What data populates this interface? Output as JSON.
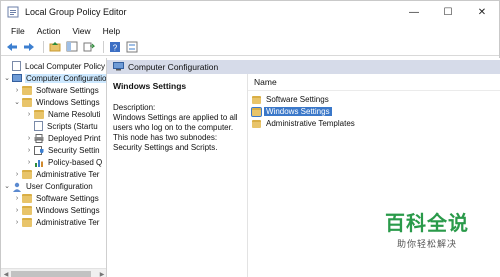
{
  "window": {
    "title": "Local Group Policy Editor",
    "controls": {
      "minimize": "—",
      "maximize": "☐",
      "close": "✕"
    }
  },
  "menu": [
    "File",
    "Action",
    "View",
    "Help"
  ],
  "toolbar": {
    "buttons": [
      "back-arrow-icon",
      "forward-arrow-icon",
      "folder-up-icon",
      "show-hide-tree-icon",
      "export-list-icon",
      "help-icon",
      "properties-icon"
    ]
  },
  "tree": {
    "items": [
      {
        "label": "Local Computer Policy",
        "level": 0,
        "expander": "",
        "icon": "doc-icon"
      },
      {
        "label": "Computer Configuratio",
        "level": 0,
        "expander": "v",
        "icon": "computer-icon",
        "selected": true
      },
      {
        "label": "Software Settings",
        "level": 1,
        "expander": ">",
        "icon": "folder-icon"
      },
      {
        "label": "Windows Settings",
        "level": 1,
        "expander": "v",
        "icon": "folder-icon"
      },
      {
        "label": "Name Resoluti",
        "level": 2,
        "expander": ">",
        "icon": "folder-icon"
      },
      {
        "label": "Scripts (Startu",
        "level": 2,
        "expander": "",
        "icon": "script-icon"
      },
      {
        "label": "Deployed Print",
        "level": 2,
        "expander": ">",
        "icon": "printer-icon"
      },
      {
        "label": "Security Settin",
        "level": 2,
        "expander": ">",
        "icon": "security-icon"
      },
      {
        "label": "Policy-based Q",
        "level": 2,
        "expander": ">",
        "icon": "chart-icon"
      },
      {
        "label": "Administrative Ter",
        "level": 1,
        "expander": ">",
        "icon": "folder-icon"
      },
      {
        "label": "User Configuration",
        "level": 0,
        "expander": "v",
        "icon": "user-icon"
      },
      {
        "label": "Software Settings",
        "level": 1,
        "expander": ">",
        "icon": "folder-icon"
      },
      {
        "label": "Windows Settings",
        "level": 1,
        "expander": ">",
        "icon": "folder-icon"
      },
      {
        "label": "Administrative Ter",
        "level": 1,
        "expander": ">",
        "icon": "folder-icon"
      }
    ]
  },
  "header": {
    "title": "Computer Configuration"
  },
  "description": {
    "title": "Windows Settings",
    "heading": "Description:",
    "body": "Windows Settings are applied to all users who log on to the computer. This node has two subnodes: Security Settings and Scripts."
  },
  "list": {
    "column_name": "Name",
    "items": [
      {
        "label": "Software Settings",
        "selected": false
      },
      {
        "label": "Windows Settings",
        "selected": true
      },
      {
        "label": "Administrative Templates",
        "selected": false
      }
    ]
  },
  "watermark": {
    "main": "百科全说",
    "sub": "助你轻松解决"
  },
  "colors": {
    "header_bar": "#d6dbe9",
    "selected_row": "#3b78c9",
    "tree_selected": "#cce8ff",
    "folder": "#e8c46a",
    "watermark_green": "#2a9a4a"
  }
}
